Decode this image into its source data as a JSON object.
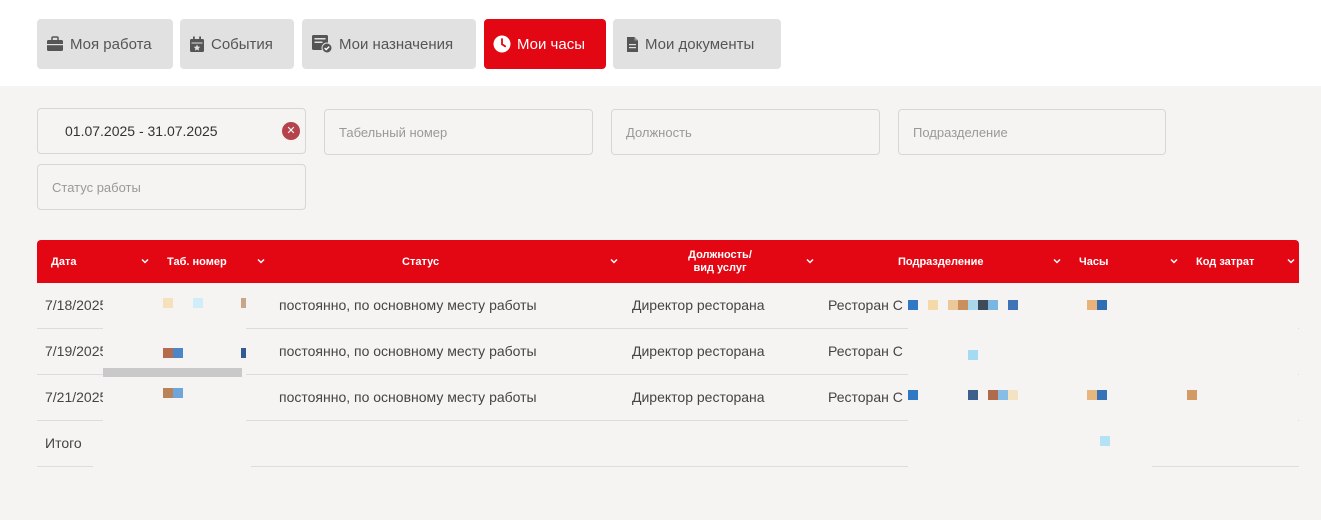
{
  "tabs": [
    {
      "label": "Моя работа",
      "icon": "briefcase-icon",
      "active": false
    },
    {
      "label": "События",
      "icon": "calendar-icon",
      "active": false
    },
    {
      "label": "Мои назначения",
      "icon": "assignments-icon",
      "active": false
    },
    {
      "label": "Мои часы",
      "icon": "clock-icon",
      "active": true
    },
    {
      "label": "Мои документы",
      "icon": "document-icon",
      "active": false
    }
  ],
  "filters": {
    "date_range_value": "01.07.2025 - 31.07.2025",
    "clear_icon": "close-icon",
    "tab_number_placeholder": "Табельный номер",
    "position_placeholder": "Должность",
    "department_placeholder": "Подразделение",
    "work_status_placeholder": "Статус работы"
  },
  "table": {
    "headers": {
      "date": "Дата",
      "tab_number": "Таб. номер",
      "status": "Статус",
      "position_line1": "Должность/",
      "position_line2": "вид услуг",
      "department": "Подразделение",
      "hours": "Часы",
      "cost_code": "Код затрат"
    },
    "rows": [
      {
        "date": "7/18/2025",
        "status": "постоянно, по основному месту работы",
        "position": "Директор ресторана",
        "department": "Ресторан С"
      },
      {
        "date": "7/19/2025",
        "status": "постоянно, по основному месту работы",
        "position": "Директор ресторана",
        "department": "Ресторан С"
      },
      {
        "date": "7/21/2025",
        "status": "постоянно, по основному месту работы",
        "position": "Директор ресторана",
        "department": "Ресторан С"
      }
    ],
    "total_label": "Итого"
  },
  "colors": {
    "accent": "#e30613",
    "tab_inactive": "#e1e1e1",
    "page_bg": "#f5f4f2"
  }
}
